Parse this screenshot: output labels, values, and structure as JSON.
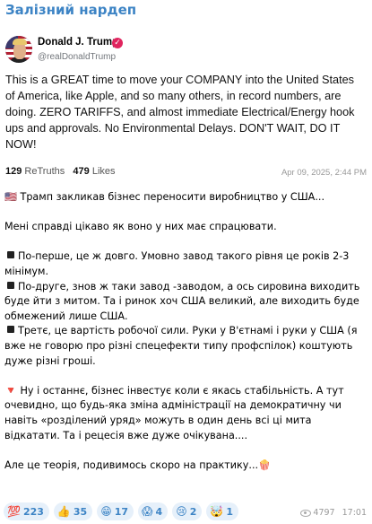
{
  "channel": {
    "name": "Залізний нардеп"
  },
  "tweet": {
    "author_name": "Donald J. Trump",
    "author_handle": "@realDonaldTrump",
    "text": "This is a GREAT time to move your COMPANY into the United States of America, like Apple, and so many others, in record numbers, are doing. ZERO TARIFFS, and almost immediate Electrical/Energy hook ups and approvals. No Environmental Delays. DON'T WAIT, DO IT NOW!",
    "retruths_count": "129",
    "retruths_label": "ReTruths",
    "likes_count": "479",
    "likes_label": "Likes",
    "date": "Apr 09, 2025, 2:44 PM"
  },
  "post": {
    "line1": "Трамп закликав бізнес переносити виробництво у США...",
    "line2": "Мені справді цікаво як воно у них має спрацювати.",
    "point1": "По-перше, це ж довго. Умовно завод такого рівня це років 2-3 мінімум.",
    "point2": "По-друге, знов ж таки завод -заводом, а ось сировина виходить буде йти з митом. Та і ринок хоч США великий, але виходить буде обмежений лише США.",
    "point3": "Третє, це вартість робочої сили. Руки у В'єтнамі і руки у США (я вже не говорю про різні спецефекти типу профспілок) коштують дуже різні гроші.",
    "point4": "Ну і останнє, бізнес інвестує коли є якась стабільність. А тут очевидно, що будь-яка зміна адміністрації на демократичну чи навіть «розділений уряд» можуть в один день всі ці мита відкатати. Та і рецесія вже дуже очікувана....",
    "closing": "Але це теорія, подивимось скоро на практику..."
  },
  "reactions": [
    {
      "icon": "💯",
      "count": "223"
    },
    {
      "icon": "👍",
      "count": "35"
    },
    {
      "icon": "😁",
      "count": "17"
    },
    {
      "icon": "😱",
      "count": "4"
    },
    {
      "icon": "😢",
      "count": "2"
    },
    {
      "icon": "🤯",
      "count": "1"
    }
  ],
  "message_meta": {
    "views": "4797",
    "time": "17:01"
  }
}
